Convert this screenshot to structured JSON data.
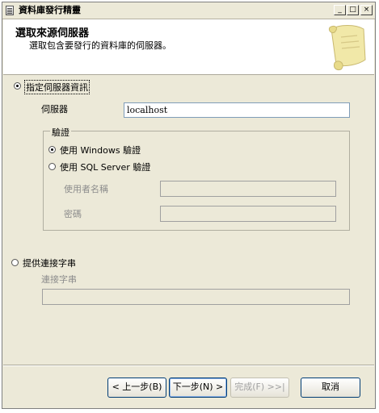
{
  "window": {
    "title": "資料庫發行精靈",
    "controls": {
      "minimize": "_",
      "maximize": "□",
      "close": "×"
    }
  },
  "header": {
    "title": "選取來源伺服器",
    "subtitle": "選取包含要發行的資料庫的伺服器。",
    "icon": "scroll-icon"
  },
  "server_info": {
    "radio_label": "指定伺服器資訊",
    "selected": true,
    "server_label": "伺服器",
    "server_value": "localhost"
  },
  "auth": {
    "legend": "驗證",
    "windows_label": "使用 Windows 驗證",
    "windows_selected": true,
    "sql_label": "使用 SQL Server 驗證",
    "sql_selected": false,
    "username_label": "使用者名稱",
    "username_value": "",
    "password_label": "密碼",
    "password_value": ""
  },
  "connection_string": {
    "radio_label": "提供連接字串",
    "selected": false,
    "field_label": "連接字串",
    "value": ""
  },
  "buttons": {
    "back": "< 上一步(B)",
    "next": "下一步(N) >",
    "finish": "完成(F) >>|",
    "cancel": "取消"
  }
}
